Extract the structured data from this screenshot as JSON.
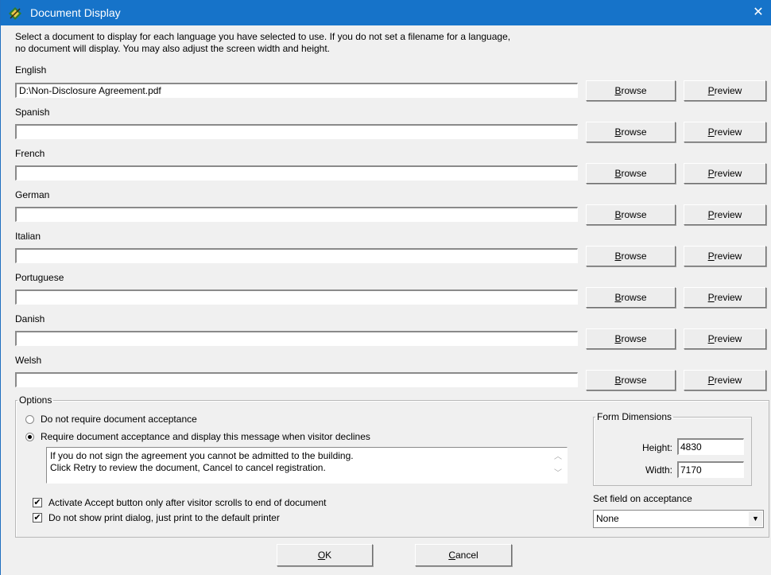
{
  "window": {
    "title": "Document Display",
    "close_symbol": "✕"
  },
  "intro": {
    "line1": "Select a document to display for each language you have selected to use. If you do not set a filename for a language,",
    "line2": "no document will display. You may also adjust the screen width and height."
  },
  "languages": [
    {
      "label": "English",
      "value": "D:\\Non-Disclosure Agreement.pdf"
    },
    {
      "label": "Spanish",
      "value": ""
    },
    {
      "label": "French",
      "value": ""
    },
    {
      "label": "German",
      "value": ""
    },
    {
      "label": "Italian",
      "value": ""
    },
    {
      "label": "Portuguese",
      "value": ""
    },
    {
      "label": "Danish",
      "value": ""
    },
    {
      "label": "Welsh",
      "value": ""
    }
  ],
  "buttons": {
    "browse": {
      "mnemonic": "B",
      "rest": "rowse"
    },
    "preview": {
      "mnemonic": "P",
      "rest": "review"
    },
    "ok": {
      "mnemonic": "O",
      "rest": "K"
    },
    "cancel": {
      "mnemonic": "C",
      "rest": "ancel"
    }
  },
  "options": {
    "legend": "Options",
    "radio_no_accept": {
      "label": "Do not require document acceptance",
      "checked": false
    },
    "radio_require_accept": {
      "label": "Require document acceptance and display this message when visitor declines",
      "checked": true
    },
    "decline_message": {
      "line1": "If you do not sign the agreement you cannot be admitted to the building.",
      "line2": "Click Retry to review the document, Cancel to cancel registration."
    },
    "check_scroll": {
      "label": "Activate Accept button only after visitor scrolls to end of document",
      "checked": true
    },
    "check_print": {
      "label": "Do not show print dialog, just print to the default printer",
      "checked": true
    }
  },
  "form_dimensions": {
    "legend": "Form Dimensions",
    "height_label": "Height:",
    "height_value": "4830",
    "width_label": "Width:",
    "width_value": "7170"
  },
  "acceptance": {
    "label": "Set field on acceptance",
    "selected": "None"
  }
}
